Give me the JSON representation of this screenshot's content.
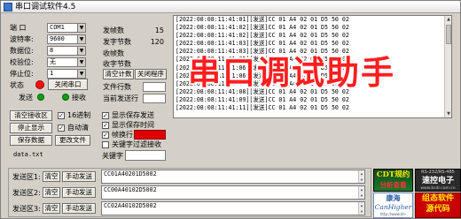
{
  "window": {
    "title": "串口调试软件4.5",
    "overlay_text": "串口调试助手"
  },
  "settings": {
    "port_label": "端 口",
    "port_value": "COM1",
    "baud_label": "波特率:",
    "baud_value": "9600",
    "databits_label": "数据位:",
    "databits_value": "8",
    "parity_label": "校验位:",
    "parity_value": "无",
    "stopbits_label": "停止位:",
    "stopbits_value": "1",
    "status_label": "状态",
    "close_port_button": "关闭串口",
    "send_label": "发送",
    "receive_label": "接收"
  },
  "counters": {
    "sent_frames_label": "发帧数",
    "sent_frames_value": "15",
    "sent_bytes_label": "发字节数",
    "sent_bytes_value": "120",
    "recv_frames_label": "收帧数",
    "recv_bytes_label": "收字节数",
    "clear_count_button": "清空计数",
    "close_program_button": "关闭程序",
    "file_lines_label": "文件行数",
    "current_line_label": "当前发送行"
  },
  "log": {
    "lines": [
      "[2022:08:08:11:41:01][发送]CC 01 A4 02 01 D5 50 02",
      "[2022:08:08:11:41:02][发送]CC 01 A4 02 01 D5 50 02",
      "[2022:08:08:11:41:02][发送]CC 01 A4 02 01 D5 50 02",
      "[2022:08:08:11:41:03][发送]CC 01 A4 02 01 D5 50 02",
      "[2022:08:08:11:41:03][发送]CC 01 A4 02 01 D5 50 02",
      "[2022:08:08:11:41:05][发送]CC 01 A4 02 01 D5 50 02",
      "[2022:08:08:11:41:06][发送]CC 01 A4 02 01 D5 50 02",
      "[2022:08:08:11:41:06][发送]CC 01 A4 02 01 D5 50 02",
      "[2022:08:08:11:41:07][发送]CC 01 A4 02 01 D5 50 02",
      "[2022:08:08:11:41:08][发送]CC 01 A4 02 01 D5 50 02",
      "[2022:08:08:11:41:09][发送]CC 01 A4 02 01 D5 50 02",
      "[2022:08:08:11:41:11][发送]CC 01 A4 02 01 D5 50 02"
    ]
  },
  "receive_controls": {
    "clear_receive_button": "清空接收区",
    "hex_label": "16进制",
    "stop_display_button": "停止显示",
    "auto_clear_label": "自动清",
    "save_data_button": "保存数据",
    "change_file_button": "更改文件",
    "file_name": "data.txt"
  },
  "options": {
    "show_saved_send": "显示保存发送",
    "show_saved_time": "显示保存时间",
    "frame_newline": "帧换行",
    "unlock_frame": "",
    "keyword_filter": "关键字过滤接收",
    "keyword_label": "关键字"
  },
  "send_areas": [
    {
      "label": "发送区1:",
      "clear": "清空",
      "manual": "手动发送",
      "value": "CC01A40201D5002"
    },
    {
      "label": "发送区2:",
      "clear": "清空",
      "manual": "手动发送",
      "value": "CC00A40102D5002"
    },
    {
      "label": "发送区3:",
      "clear": "清空",
      "manual": "手动发送",
      "value": "CC02A40102D5002"
    }
  ],
  "logos": {
    "cdt_top": "CDT规约",
    "cdt_bottom": "分析查看",
    "rs_top": "RS-232/RS-485",
    "rs_main": "速控电子",
    "rs_bottom": "www.bsdr.com.cn",
    "kang_top": "康海",
    "kang_main": "CanHigher",
    "kang_bottom": "http://www.kh-design.com",
    "custom_top": "组态软件",
    "custom_bottom": "源代码"
  },
  "colors": {
    "status_led": "#ff1010",
    "receive_led": "#10a010",
    "overlay_text": "#ff1e1e",
    "highlight": "#e00000"
  }
}
